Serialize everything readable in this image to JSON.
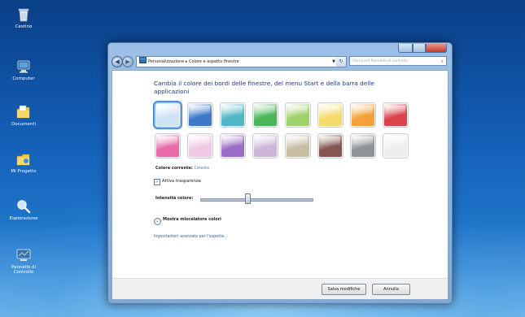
{
  "desktop": {
    "icons": [
      {
        "label": "Cestino",
        "icon": "recycle-bin-icon"
      },
      {
        "label": "Computer",
        "icon": "computer-icon"
      },
      {
        "label": "Documenti",
        "icon": "documents-folder-icon"
      },
      {
        "label": "Mi Progetto",
        "icon": "projects-folder-icon"
      },
      {
        "label": "Esplorazione",
        "icon": "search-magnifier-icon"
      },
      {
        "label": "Pannello di Controllo",
        "icon": "control-panel-icon"
      }
    ]
  },
  "window": {
    "breadcrumb": "Personalizzazione  ▸  Colore e aspetto finestre",
    "search_placeholder": "Cerca nel Pannello di controllo",
    "heading": "Cambia il colore dei bordi delle finestre, del menu Start e della barra delle applicazioni",
    "swatch_colors": [
      "#cfe3f6",
      "#3e79c9",
      "#4fb7c6",
      "#4cb55a",
      "#9ed06b",
      "#f4dc6c",
      "#f3a23a",
      "#d9444a",
      "#e86aa6",
      "#efc9e3",
      "#9b6cc6",
      "#cdb7d8",
      "#c8bca2",
      "#84564f",
      "#8f9396",
      "#eeeeee"
    ],
    "selected_swatch": 0,
    "current_color_label": "Colore corrente:",
    "current_color_value": "Celeste",
    "transparency_label": "Attiva trasparenza",
    "transparency_checked": true,
    "intensity_label": "Intensità colore:",
    "intensity_level": 0.42,
    "mixer_label": "Mostra miscelatore colori",
    "advanced_link": "Impostazioni avanzate per l'aspetto...",
    "save_label": "Salva modifiche",
    "cancel_label": "Annulla"
  }
}
